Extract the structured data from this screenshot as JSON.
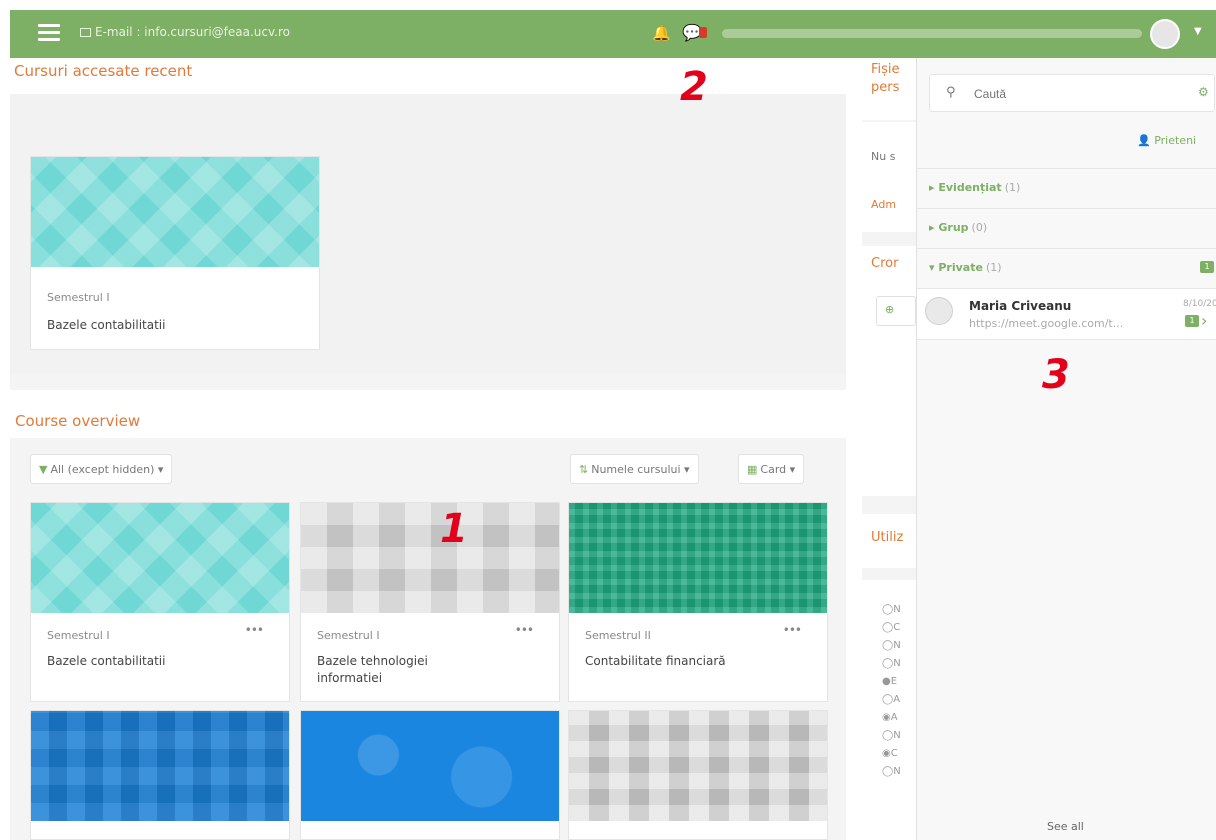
{
  "navbar": {
    "email_text": "E-mail : info.cursuri@feaa.ucv.ro",
    "accent_color": "#7daf64"
  },
  "recent": {
    "title": "Cursuri accesate recent",
    "card": {
      "semester": "Semestrul I",
      "name": "Bazele contabilitatii"
    }
  },
  "overview": {
    "title": "Course overview",
    "filter_label": "All (except hidden)",
    "sort_label": "Numele cursului",
    "view_label": "Card",
    "courses": [
      {
        "semester": "Semestrul I",
        "name": "Bazele contabilitatii"
      },
      {
        "semester": "Semestrul I",
        "name": "Bazele tehnologiei informatiei"
      },
      {
        "semester": "Semestrul II",
        "name": "Contabilitate financiară"
      }
    ]
  },
  "right_column": {
    "files_title_line1": "Fișie",
    "files_title_line2": "pers",
    "files_text": "Nu s",
    "files_link": "Adm",
    "calendar_title": "Cror",
    "users_title": "Utiliz",
    "user_initials": [
      "N",
      "C",
      "N",
      "N",
      "E",
      "A",
      "A",
      "N",
      "C",
      "N"
    ]
  },
  "drawer": {
    "search_placeholder": "Caută",
    "friends_label": "Prieteni",
    "sections": [
      {
        "label": "Evidențiat",
        "count": "(1)"
      },
      {
        "label": "Grup",
        "count": "(0)"
      },
      {
        "label": "Private",
        "count": "(1)",
        "badge": "1"
      }
    ],
    "conversation": {
      "name": "Maria Criveanu",
      "preview": "https://meet.google.com/t...",
      "date": "8/10/20",
      "unread": "1"
    },
    "see_all": "See all"
  },
  "annotations": [
    "1",
    "2",
    "3"
  ]
}
